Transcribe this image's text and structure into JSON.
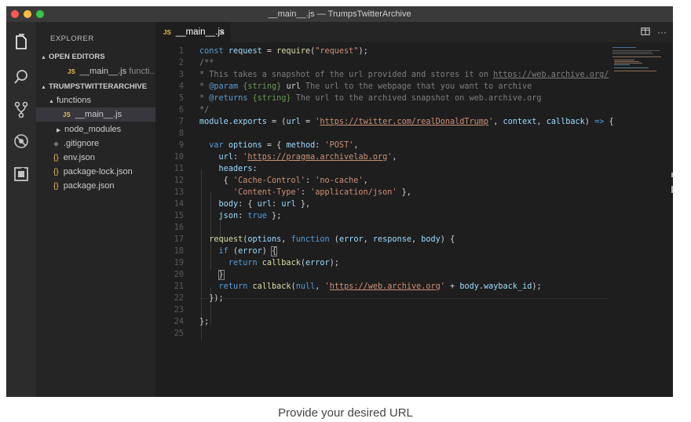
{
  "window": {
    "title": "__main__.js — TrumpsTwitterArchive"
  },
  "activity_bar": [
    "files-icon",
    "search-icon",
    "source-control-icon",
    "debug-icon",
    "extensions-icon"
  ],
  "sidebar": {
    "header": "EXPLORER",
    "open_editors_label": "OPEN EDITORS",
    "open_editor": {
      "name": "__main__.js",
      "folder": "functi..."
    },
    "project_label": "TRUMPSTWITTERARCHIVE",
    "tree": [
      {
        "name": "functions",
        "type": "folder",
        "state": "expanded"
      },
      {
        "name": "__main__.js",
        "type": "js",
        "selected": true
      },
      {
        "name": "node_modules",
        "type": "folder",
        "state": "collapsed"
      },
      {
        "name": ".gitignore",
        "type": "git"
      },
      {
        "name": "env.json",
        "type": "json"
      },
      {
        "name": "package-lock.json",
        "type": "json"
      },
      {
        "name": "package.json",
        "type": "json"
      }
    ]
  },
  "tab": {
    "badge": "JS",
    "name": "__main__.js",
    "close": "×"
  },
  "icons": {
    "js_badge": "JS",
    "json_badge": "{}",
    "caret_down": "▲",
    "caret_right": "▶"
  },
  "code_lines": [
    "1",
    "2",
    "3",
    "4",
    "5",
    "6",
    "7",
    "8",
    "9",
    "10",
    "11",
    "12",
    "13",
    "14",
    "15",
    "16",
    "17",
    "18",
    "19",
    "20",
    "21",
    "22",
    "23",
    "24",
    "25"
  ],
  "caption": "Provide your desired URL",
  "colors": {
    "keyword": "#569cd6",
    "string": "#ce9178",
    "comment": "#6a9955"
  }
}
